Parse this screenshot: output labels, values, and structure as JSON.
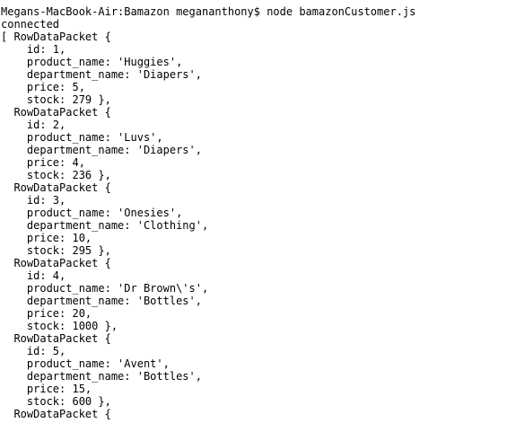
{
  "terminal": {
    "lines": [
      "Megans-MacBook-Air:Bamazon megananthony$ node bamazonCustomer.js",
      "connected",
      "[ RowDataPacket {",
      "    id: 1,",
      "    product_name: 'Huggies',",
      "    department_name: 'Diapers',",
      "    price: 5,",
      "    stock: 279 },",
      "  RowDataPacket {",
      "    id: 2,",
      "    product_name: 'Luvs',",
      "    department_name: 'Diapers',",
      "    price: 4,",
      "    stock: 236 },",
      "  RowDataPacket {",
      "    id: 3,",
      "    product_name: 'Onesies',",
      "    department_name: 'Clothing',",
      "    price: 10,",
      "    stock: 295 },",
      "  RowDataPacket {",
      "    id: 4,",
      "    product_name: 'Dr Brown\\'s',",
      "    department_name: 'Bottles',",
      "    price: 20,",
      "    stock: 1000 },",
      "  RowDataPacket {",
      "    id: 5,",
      "    product_name: 'Avent',",
      "    department_name: 'Bottles',",
      "    price: 15,",
      "    stock: 600 },",
      "  RowDataPacket {"
    ]
  }
}
